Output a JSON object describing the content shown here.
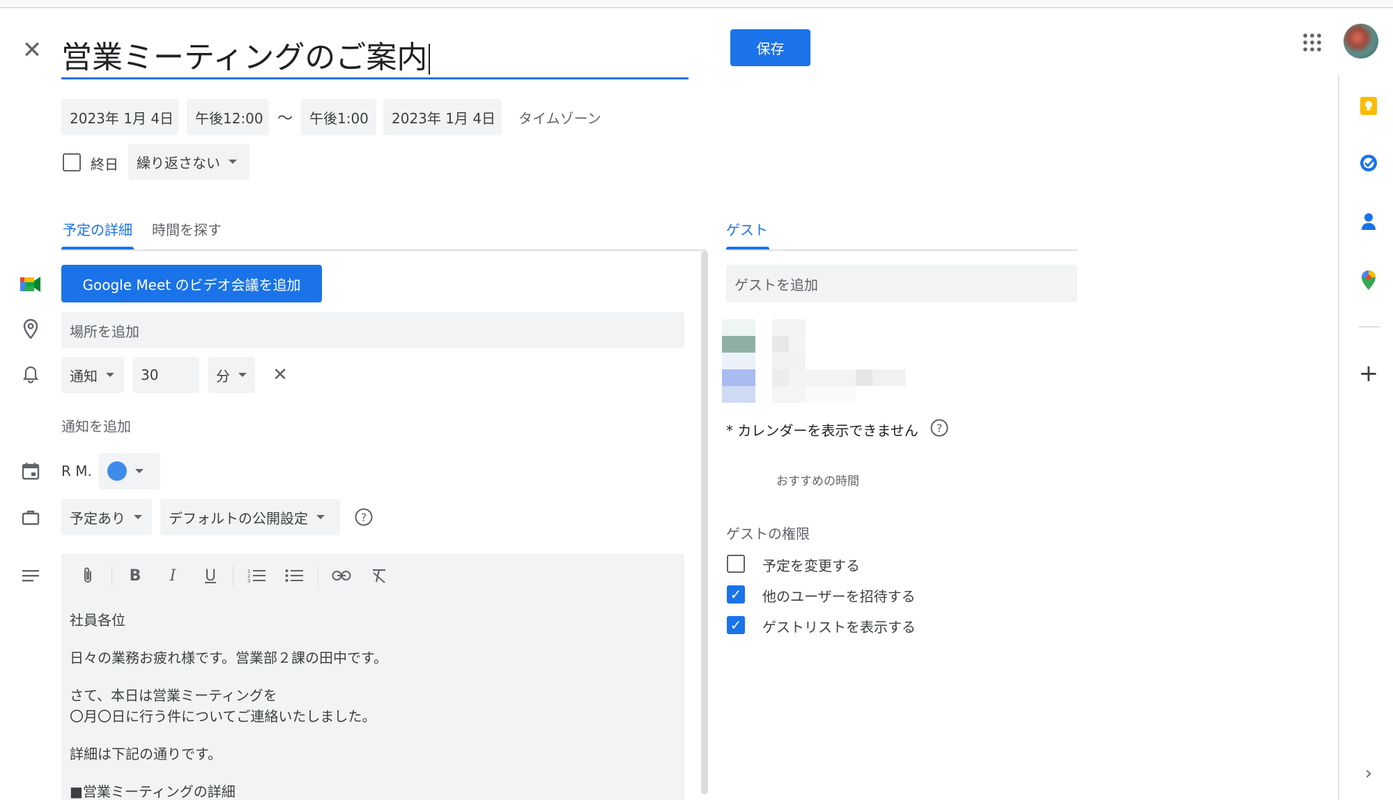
{
  "header": {
    "close_label": "✕",
    "title": "営業ミーティングのご案内",
    "save_label": "保存"
  },
  "datetime": {
    "start_date": "2023年 1月 4日",
    "start_time": "午後12:00",
    "separator": "〜",
    "end_time": "午後1:00",
    "end_date": "2023年 1月 4日",
    "timezone_label": "タイムゾーン"
  },
  "options": {
    "all_day_label": "終日",
    "repeat_label": "繰り返さない"
  },
  "tabs": {
    "details": "予定の詳細",
    "find_time": "時間を探す",
    "guests": "ゲスト"
  },
  "details": {
    "meet_button": "Google Meet のビデオ会議を追加",
    "location_placeholder": "場所を追加",
    "notification_type": "通知",
    "notification_value": "30",
    "notification_unit": "分",
    "add_notification": "通知を追加",
    "calendar_owner": "R M.",
    "calendar_color": "#3f8bea",
    "busy_status": "予定あり",
    "visibility": "デフォルトの公開設定"
  },
  "description": {
    "lines": [
      "社員各位",
      "日々の業務お疲れ様です。営業部２課の田中です。",
      "さて、本日は営業ミーティングを",
      "〇月〇日に行う件についてご連絡いたしました。",
      "詳細は下記の通りです。",
      "■営業ミーティングの詳細"
    ]
  },
  "guests": {
    "add_placeholder": "ゲストを追加",
    "calendar_unavailable": "* カレンダーを表示できません",
    "suggested_times": "おすすめの時間",
    "permissions_title": "ゲストの権限",
    "permissions": [
      {
        "label": "予定を変更する",
        "checked": false
      },
      {
        "label": "他のユーザーを招待する",
        "checked": true
      },
      {
        "label": "ゲストリストを表示する",
        "checked": true
      }
    ]
  },
  "colors": {
    "accent": "#1a73e8",
    "keep": "#fbbc04",
    "tasks": "#1a73e8",
    "contacts": "#1a73e8",
    "maps": "#34a853"
  }
}
